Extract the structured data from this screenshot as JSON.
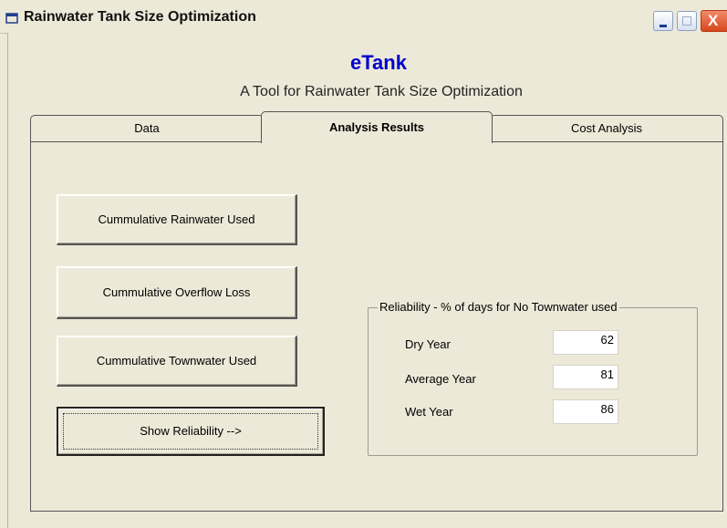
{
  "window": {
    "title": "Rainwater Tank Size Optimization",
    "close_glyph": "X"
  },
  "header": {
    "app_name": "eTank",
    "subtitle": "A Tool for Rainwater Tank Size Optimization"
  },
  "tabs": [
    {
      "label": "Data",
      "selected": false
    },
    {
      "label": "Analysis Results",
      "selected": true
    },
    {
      "label": "Cost Analysis",
      "selected": false
    }
  ],
  "buttons": {
    "rainwater_used": "Cummulative Rainwater Used",
    "overflow_loss": "Cummulative Overflow Loss",
    "townwater_used": "Cummulative Townwater Used",
    "show_reliability": "Show Reliability -->"
  },
  "reliability": {
    "legend": "Reliability - % of days for No Townwater used",
    "rows": [
      {
        "label": "Dry Year",
        "value": "62"
      },
      {
        "label": "Average Year",
        "value": "81"
      },
      {
        "label": "Wet Year",
        "value": "86"
      }
    ]
  },
  "colors": {
    "accent": "#0000cc",
    "window_bg": "#ece9d8",
    "close_button": "#d8471e"
  }
}
